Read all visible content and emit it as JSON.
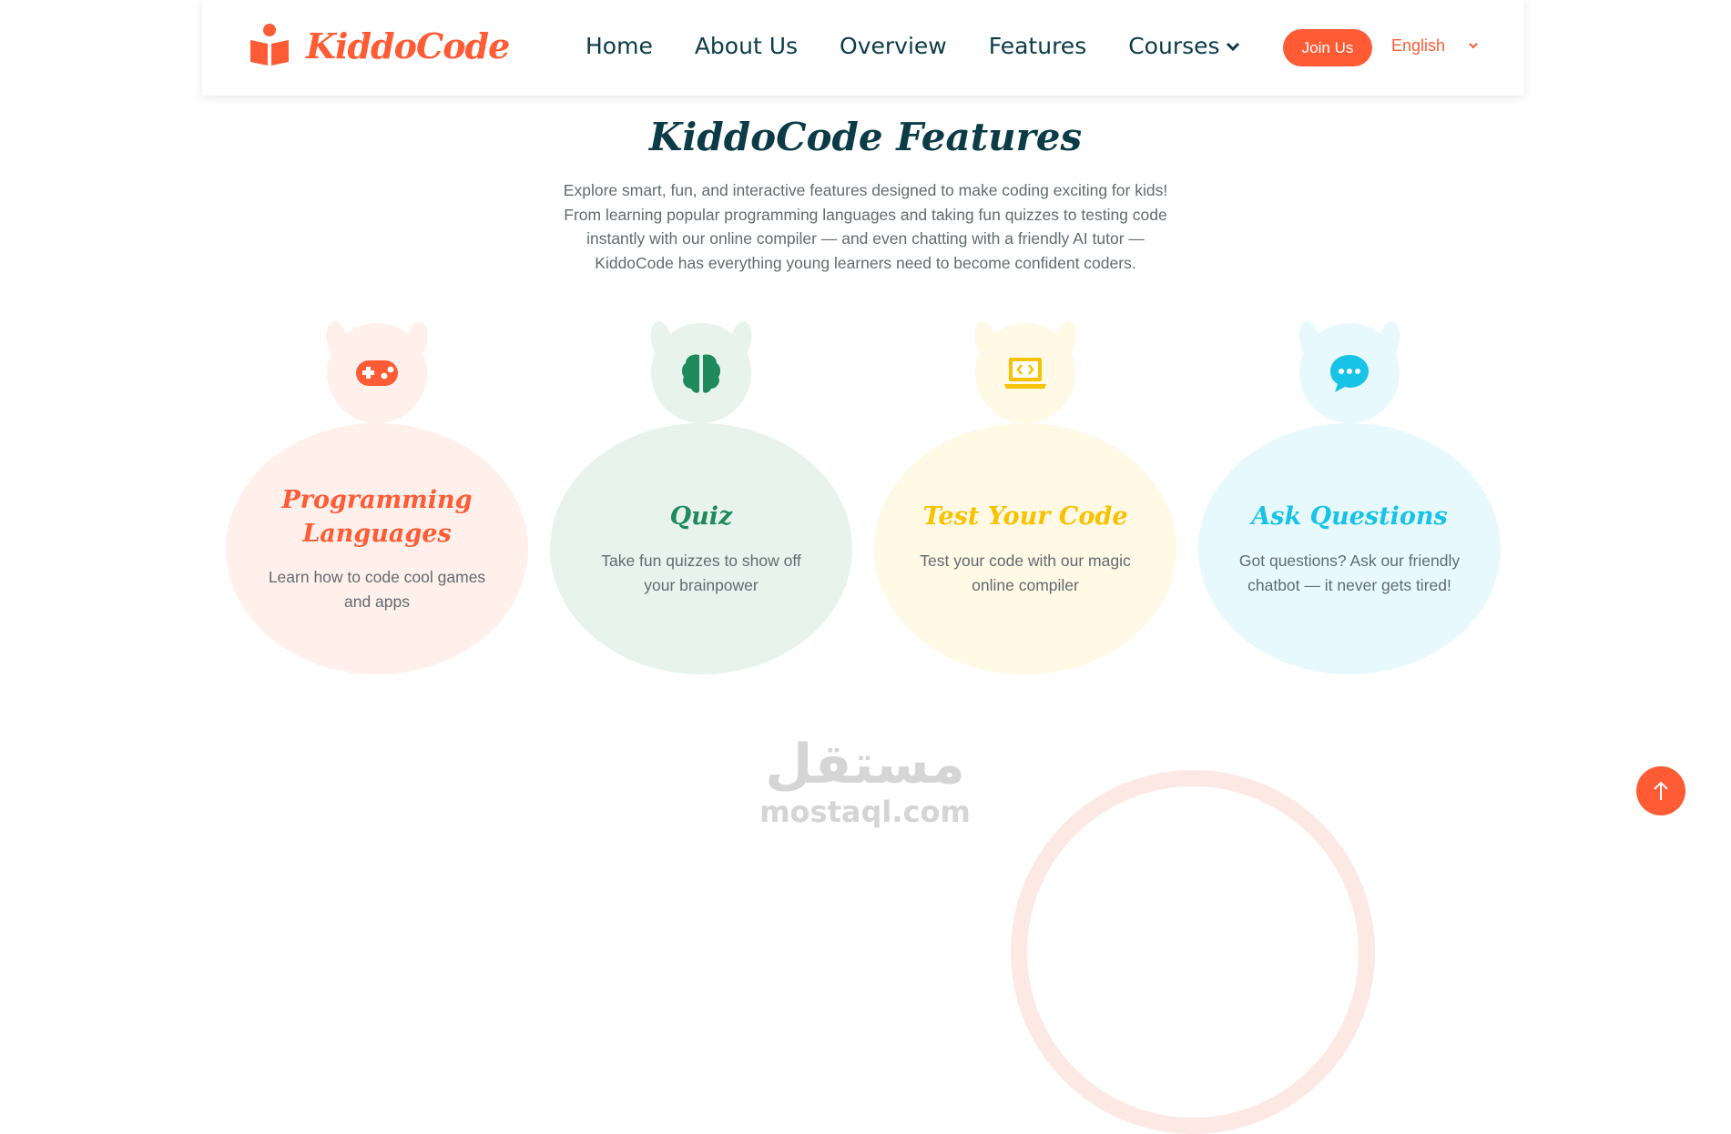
{
  "brand": {
    "name": "KiddoCode",
    "color": "#ff5b35",
    "icon": "reading-kid-icon"
  },
  "nav": {
    "links": [
      "Home",
      "About Us",
      "Overview",
      "Features",
      "Courses"
    ],
    "courses_icon": "chevron-down-icon",
    "join_label": "Join Us",
    "language": "English"
  },
  "features": {
    "title": "KiddoCode Features",
    "description": "Explore smart, fun, and interactive features designed to make coding exciting for kids! From learning popular programming languages and taking fun quizzes to testing code instantly with our online compiler — and even chatting with a friendly AI tutor — KiddoCode has everything young learners need to become confident coders.",
    "cards": [
      {
        "title": "Programming Languages",
        "text": "Learn how to code cool games and apps",
        "icon": "gamepad-icon",
        "accent": "#ff5b35",
        "bg": "#fff0ec"
      },
      {
        "title": "Quiz",
        "text": "Take fun quizzes to show off your brainpower",
        "icon": "brain-icon",
        "accent": "#1f8a5b",
        "bg": "#e8f3ee"
      },
      {
        "title": "Test Your Code",
        "text": "Test your code with our magic online compiler",
        "icon": "laptop-code-icon",
        "accent": "#f7c200",
        "bg": "#fff9e6"
      },
      {
        "title": "Ask Questions",
        "text": "Got questions? Ask our friendly chatbot — it never gets tired!",
        "icon": "chat-bubble-icon",
        "accent": "#17c3e6",
        "bg": "#e8f9fd"
      }
    ]
  },
  "watermark": {
    "arabic": "مستقل",
    "latin": "mostaql.com"
  },
  "scroll_top_icon": "arrow-up-icon"
}
